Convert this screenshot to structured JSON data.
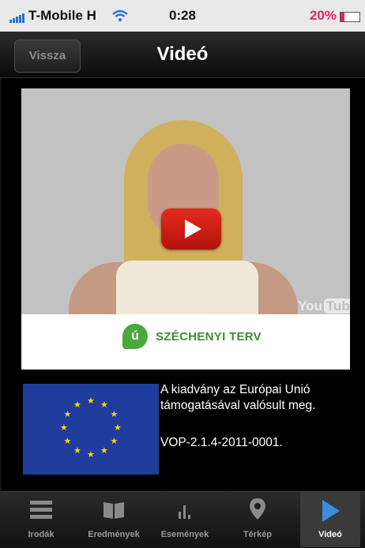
{
  "status": {
    "carrier": "T-Mobile H",
    "time": "0:28",
    "battery": "20%"
  },
  "nav": {
    "back_label": "Vissza",
    "title": "Videó"
  },
  "video": {
    "logo_text": "SZÉCHENYI TERV",
    "logo_mark": "ú",
    "watermark": "You",
    "watermark_box": "Tube"
  },
  "notice": {
    "text": "A kiadvány az Európai Unió támogatásával valósult meg.",
    "code": "VOP-2.1.4-2011-0001."
  },
  "tabs": [
    {
      "label": "Irodák",
      "icon": "list-icon"
    },
    {
      "label": "Eredmények",
      "icon": "book-icon"
    },
    {
      "label": "Események",
      "icon": "bar-chart-icon"
    },
    {
      "label": "Térkép",
      "icon": "map-pin-icon"
    },
    {
      "label": "Videó",
      "icon": "play-icon",
      "active": true
    }
  ],
  "colors": {
    "accent_active_tab": "#3a3a3a",
    "play_red": "#e32b1d",
    "eu_blue": "#1f3d9c",
    "eu_star": "#ffd800",
    "szechenyi_green": "#4aa83c",
    "battery_pink": "#e0246a"
  }
}
